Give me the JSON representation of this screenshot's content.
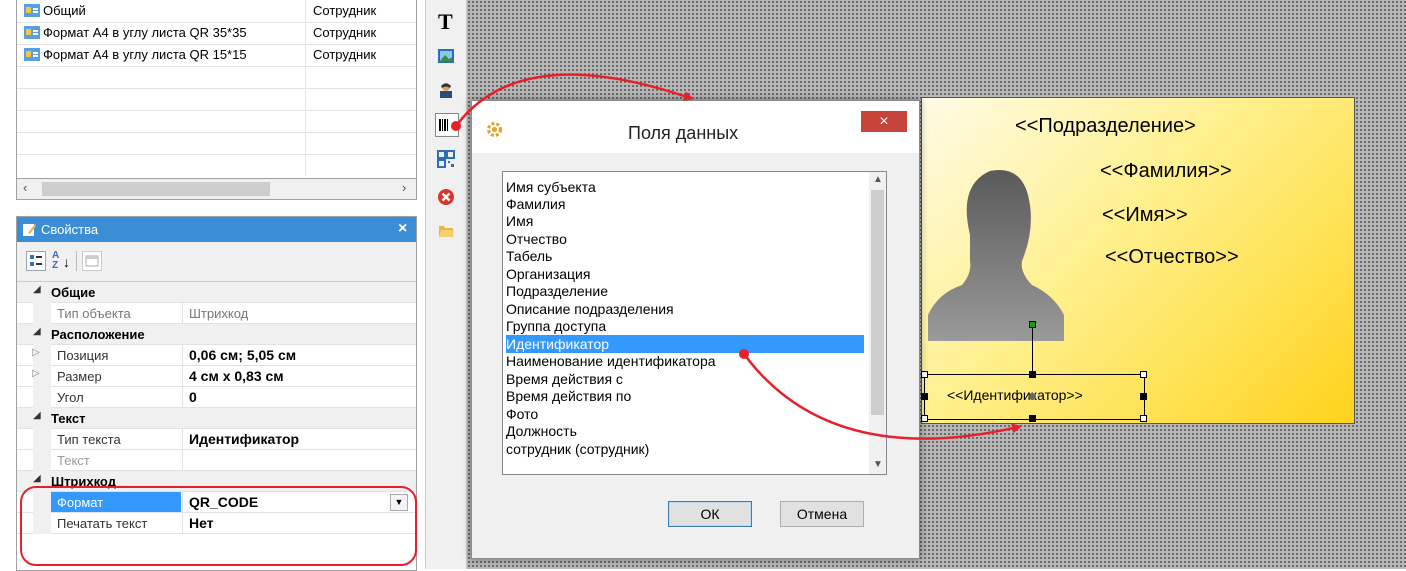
{
  "templates": {
    "rows": [
      {
        "name": "Общий",
        "type": "Сотрудник"
      },
      {
        "name": "Формат А4 в углу листа QR 35*35",
        "type": "Сотрудник"
      },
      {
        "name": "Формат А4 в углу листа QR 15*15",
        "type": "Сотрудник"
      }
    ]
  },
  "properties": {
    "title": "Свойства",
    "sort_label": "A Z",
    "categories": {
      "general": "Общие",
      "layout": "Расположение",
      "text": "Текст",
      "barcode": "Штрихкод"
    },
    "rows": {
      "object_type": {
        "name": "Тип объекта",
        "value": "Штрихкод"
      },
      "position": {
        "name": "Позиция",
        "value": "0,06 см; 5,05 см"
      },
      "size": {
        "name": "Размер",
        "value": "4 см x 0,83 см"
      },
      "angle": {
        "name": "Угол",
        "value": "0"
      },
      "text_type": {
        "name": "Тип текста",
        "value": "Идентификатор"
      },
      "text": {
        "name": "Текст",
        "value": ""
      },
      "format": {
        "name": "Формат",
        "value": "QR_CODE"
      },
      "print_text": {
        "name": "Печатать текст",
        "value": "Нет"
      }
    }
  },
  "toolbar": {
    "text_tool_glyph": "T"
  },
  "dialog": {
    "title": "Поля данных",
    "close_glyph": "×",
    "fields": [
      "Имя субъекта",
      "Фамилия",
      "Имя",
      "Отчество",
      "Табель",
      "Организация",
      "Подразделение",
      "Описание подразделения",
      "Группа доступа",
      "Идентификатор",
      "Наименование идентификатора",
      "Время действия с",
      "Время действия по",
      "Фото",
      "Должность",
      "сотрудник (сотрудник)"
    ],
    "selected_field": "Идентификатор",
    "ok_label": "ОК",
    "cancel_label": "Отмена"
  },
  "card": {
    "department": "<<Подразделение>",
    "last_name": "<<Фамилия>>",
    "first_name": "<<Имя>>",
    "patronymic": "<<Отчество>>",
    "identifier": "<<Идентификатор>>"
  },
  "colors": {
    "accent_blue": "#3b8dd6",
    "selection_blue": "#3399ff",
    "annotation_red": "#e8202a",
    "card_yellow": "#ffd21a"
  }
}
